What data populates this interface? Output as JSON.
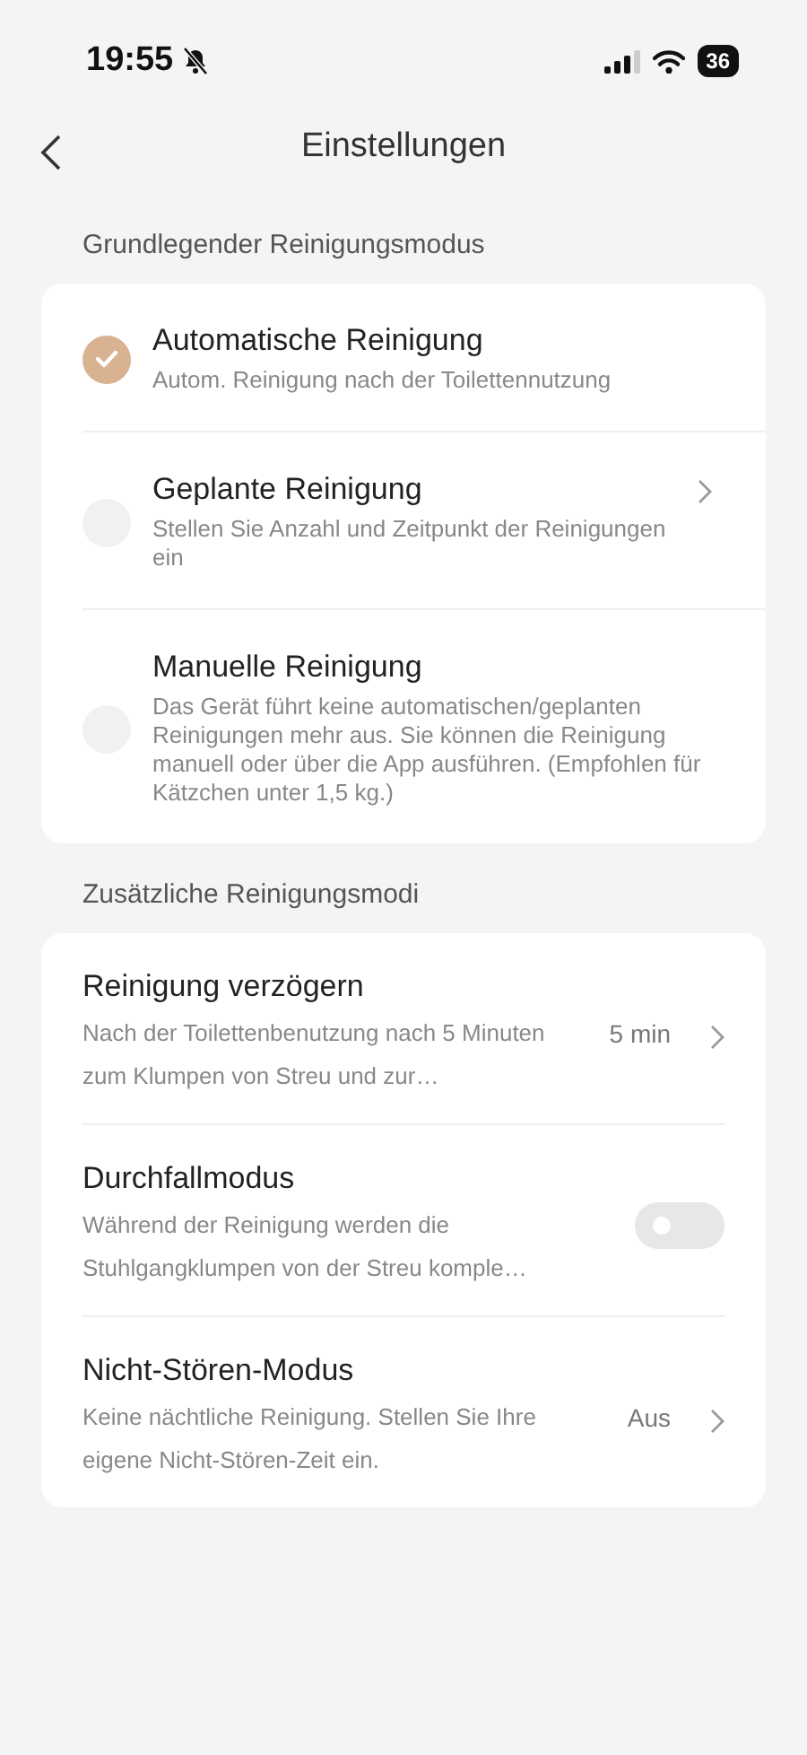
{
  "status_bar": {
    "time": "19:55",
    "silent": true,
    "battery": "36"
  },
  "nav": {
    "title": "Einstellungen"
  },
  "sections": [
    {
      "title": "Grundlegender Reinigungsmodus",
      "kind": "radio",
      "items": [
        {
          "title": "Automatische Reinigung",
          "description": "Autom. Reinigung nach der Toilettennutzung",
          "selected": true,
          "chevron": false
        },
        {
          "title": "Geplante Reinigung",
          "description": "Stellen Sie Anzahl und Zeitpunkt der Reinigungen ein",
          "selected": false,
          "chevron": true
        },
        {
          "title": "Manuelle Reinigung",
          "description": "Das Gerät führt keine automatischen/geplanten Reinigungen mehr aus. Sie können die Reinigung manuell oder über die App ausführen. (Empfohlen für Kätzchen unter 1,5 kg.)",
          "selected": false,
          "chevron": false
        }
      ]
    },
    {
      "title": "Zusätzliche Reinigungsmodi",
      "kind": "settings",
      "items": [
        {
          "kind": "value",
          "title": "Reinigung verzögern",
          "description": "Nach der Toilettenbenutzung nach 5 Minuten zum Klumpen von Streu und zur…",
          "value": "5 min"
        },
        {
          "kind": "toggle",
          "title": "Durchfallmodus",
          "description": "Während der Reinigung werden die Stuhlgangklumpen von der Streu komple…",
          "on": false
        },
        {
          "kind": "value",
          "title": "Nicht-Stören-Modus",
          "description": "Keine nächtliche Reinigung. Stellen Sie Ihre eigene Nicht-Stören-Zeit ein.",
          "value": "Aus"
        }
      ]
    }
  ]
}
